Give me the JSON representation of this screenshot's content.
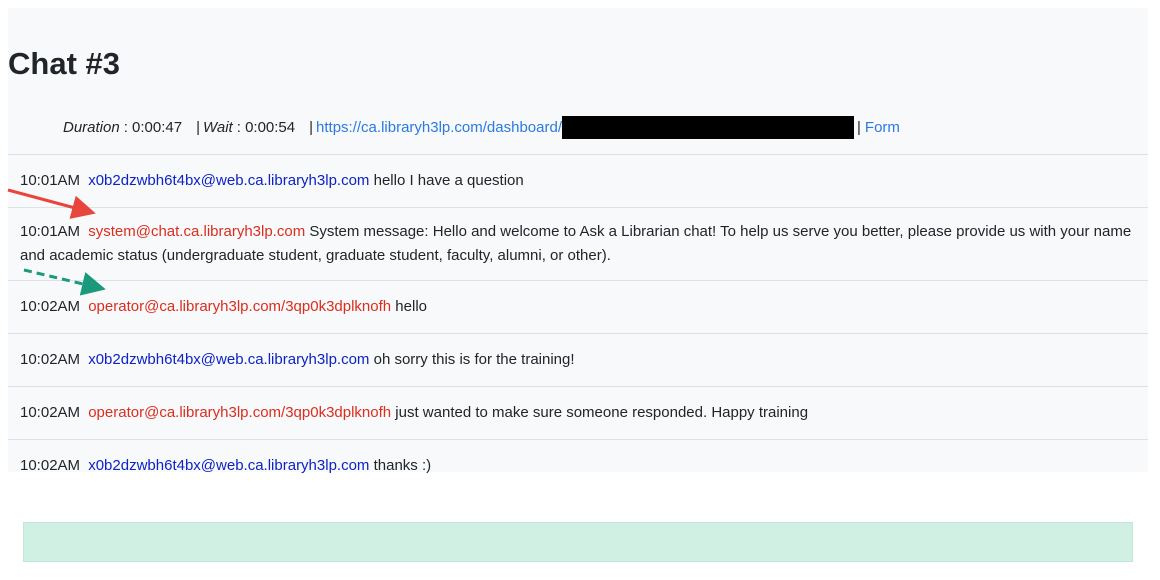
{
  "title": "Chat #3",
  "meta": {
    "duration_label": "Duration",
    "duration_value": ": 0:00:47",
    "wait_label": "Wait",
    "wait_value": ": 0:00:54",
    "pipe": "|",
    "dashboard_link": "https://ca.libraryh3lp.com/dashboard/",
    "form_link": "Form"
  },
  "messages": [
    {
      "time": "10:01AM",
      "sender": "x0b2dzwbh6t4bx@web.ca.libraryh3lp.com",
      "sender_type": "user",
      "text": "hello I have a question"
    },
    {
      "time": "10:01AM",
      "sender": "system@chat.ca.libraryh3lp.com",
      "sender_type": "system",
      "text": "System message: Hello and welcome to Ask a Librarian chat! To help us serve you better, please provide us with your name and academic status (undergraduate student, graduate student, faculty, alumni, or other)."
    },
    {
      "time": "10:02AM",
      "sender": "operator@ca.libraryh3lp.com/3qp0k3dplknofh",
      "sender_type": "operator",
      "text": "hello"
    },
    {
      "time": "10:02AM",
      "sender": "x0b2dzwbh6t4bx@web.ca.libraryh3lp.com",
      "sender_type": "user",
      "text": "oh sorry this is for the training!"
    },
    {
      "time": "10:02AM",
      "sender": "operator@ca.libraryh3lp.com/3qp0k3dplknofh",
      "sender_type": "operator",
      "text": "just wanted to make sure someone responded. Happy training"
    },
    {
      "time": "10:02AM",
      "sender": "x0b2dzwbh6t4bx@web.ca.libraryh3lp.com",
      "sender_type": "user",
      "text": "thanks :)"
    }
  ],
  "colors": {
    "user_sender": "#0d22c8",
    "operator_sender": "#dc2d1e",
    "link": "#2a7ae2",
    "panel_bg": "#f8f9fa",
    "green_box": "#d1f0e4",
    "red_arrow": "#e8453c",
    "green_arrow": "#1a9a7a"
  }
}
